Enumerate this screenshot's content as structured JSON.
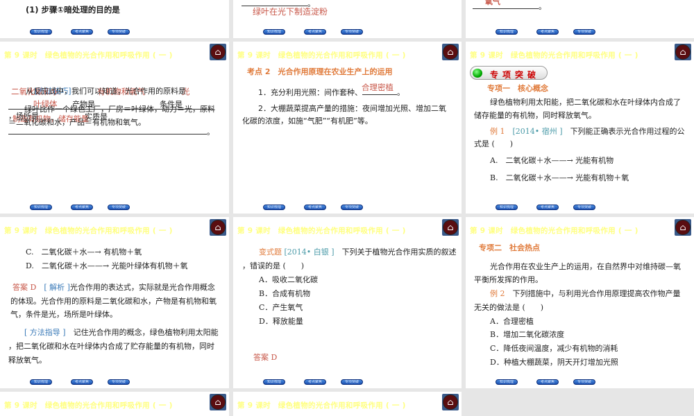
{
  "chapter_title": "第 9 课时　绿色植物的光合作用和呼吸作用 ( 一 )",
  "nav_buttons": [
    "知识梳理",
    "考点聚焦",
    "专项突破"
  ],
  "home_icon": "home-icon",
  "slide_top_left": {
    "text": "(1) 步骤①暗处理的目的是"
  },
  "slide_top_mid": {
    "answer": "绿叶在光下制造淀粉",
    "period": "。"
  },
  "slide_top_right": {
    "answer": "氧气",
    "period": "。"
  },
  "slide_r1_left": {
    "line1": "从反应式中，我们可以知道，光合作用的原料是",
    "method_tag": "[方法技巧]",
    "ans1": "二氧化碳和水",
    "ans2": "有机物和氧气",
    "ans3": "光",
    "ans4": "叶绿体",
    "products_label": "产物是",
    "condition_label": "条件是",
    "line2": "绿叶比作一个绿色工厂，厂房＝叶绿体，动力＝光，原料",
    "place_label": "，场所是",
    "ans5": "制造有机物，储存能量",
    "essence_label": "实质是",
    "line3": "＝二氧化碳和水，产品＝有机物和氧气。",
    "period": "。"
  },
  "slide_r1_mid": {
    "heading": "考点 2　光合作用原理在农业生产上的运用",
    "item1": "1．充分利用光照：间作套种、",
    "item1_answer": "合理密植",
    "period": "。",
    "item2_l1": "2．大棚蔬菜提高产量的措施：夜间增加光照、增加二氧",
    "item2_l2": "化碳的浓度，如施“气肥”“有机肥”等。"
  },
  "slide_r1_right": {
    "badge": "专项突破",
    "heading": "专项一　核心概念",
    "p1_l1": "绿色植物利用太阳能，把二氧化碳和水在叶绿体内合成了",
    "p1_l2": "储存能量的有机物，同时释放氧气。",
    "ex_label": "例 1",
    "ex_source": "[2014• 宿州 ]",
    "ex_l1": "下列能正确表示光合作用过程的公",
    "ex_l2": "式是 (　　)",
    "optA": "A.　二氧化碳＋水——→ 光能有机物",
    "optB": "B.　二氧化碳＋水——→ 光能有机物＋氧"
  },
  "slide_r2_left": {
    "optC": "C.　二氧化碳＋水—→ 有机物＋氧",
    "optD": "D.　二氧化碳＋水——→ 光能叶绿体有机物＋氧",
    "answer": "答案 D",
    "analysis_tag": "[ 解析 ]",
    "a_l1": "光合作用的表达式，实际就是光合作用概念",
    "a_l2": "的体现。光合作用的原料是二氧化碳和水，产物是有机物和氧",
    "a_l3": "气，条件是光，场所是叶绿体。",
    "method_tag": "[ 方法指导 ]",
    "m_l1": "记住光合作用的概念，绿色植物利用太阳能",
    "m_l2": "，把二氧化碳和水在叶绿体内合成了贮存能量的有机物，同时",
    "m_l3": "释放氧气。"
  },
  "slide_r2_mid": {
    "label": "变式题",
    "source": "[2014• 白银 ]",
    "q_l1": "下列关于植物光合作用实质的叙述",
    "q_l2": "，错误的是 (　　)",
    "options": [
      "A．吸收二氧化碳",
      "B．合成有机物",
      "C．产生氧气",
      "D．释放能量"
    ],
    "answer": "答案 D"
  },
  "slide_r2_right": {
    "heading": "专项二　社会热点",
    "p_l1": "光合作用在农业生产上的运用，在自然界中对维持碳—氧",
    "p_l2": "平衡所发挥的作用。",
    "ex_label": "例 2",
    "ex_l1": "下列措施中，与利用光合作用原理提高农作物产量",
    "ex_l2": "无关的做法是 (　　)",
    "options": [
      "A．合理密植",
      "B．增加二氧化碳浓度",
      "C．降低夜间温度，减少有机物的消耗",
      "D．种植大棚蔬菜，阴天开灯增加光照"
    ]
  }
}
